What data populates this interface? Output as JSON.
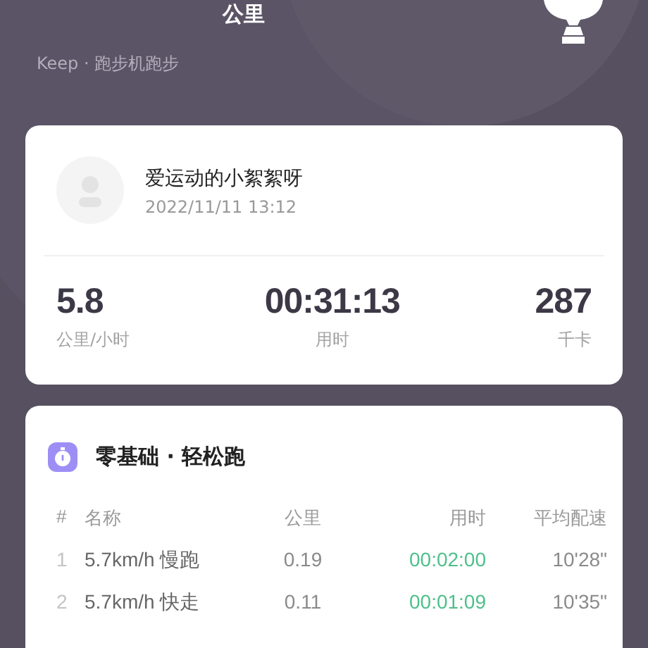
{
  "header": {
    "unit": "公里",
    "source": "Keep · 跑步机跑步"
  },
  "summary": {
    "user": {
      "name": "爱运动的小絮絮呀",
      "time": "2022/11/11 13:12"
    },
    "stats": [
      {
        "value": "5.8",
        "label": "公里/小时"
      },
      {
        "value": "00:31:13",
        "label": "用时"
      },
      {
        "value": "287",
        "label": "千卡"
      }
    ]
  },
  "plan": {
    "title": "零基础 · 轻松跑",
    "columns": [
      "#",
      "名称",
      "公里",
      "用时",
      "平均配速"
    ],
    "rows": [
      {
        "index": "1",
        "name": "5.7km/h 慢跑",
        "distance": "0.19",
        "duration": "00:02:00",
        "pace": "10'28\""
      },
      {
        "index": "2",
        "name": "5.7km/h 快走",
        "distance": "0.11",
        "duration": "00:01:09",
        "pace": "10'35\""
      }
    ]
  }
}
